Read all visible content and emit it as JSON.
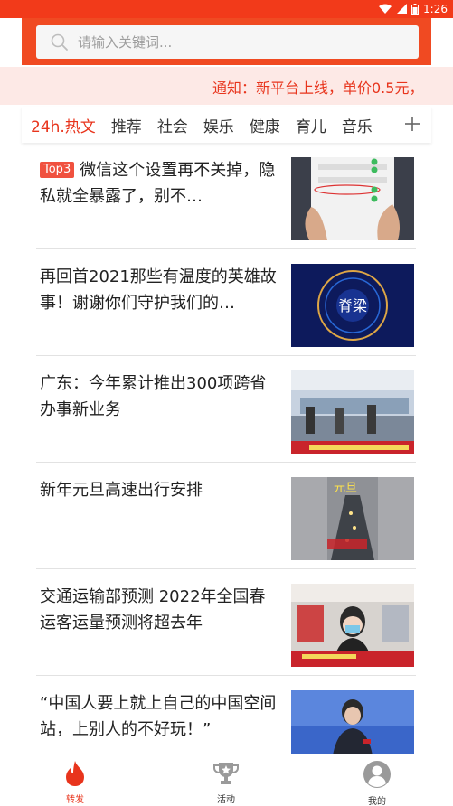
{
  "status_bar": {
    "time": "1:26"
  },
  "search": {
    "placeholder": "请输入关键词..."
  },
  "notice": {
    "text": "通知：新平台上线，单价0.5元，"
  },
  "tabs": [
    {
      "label": "24h.热文",
      "active": true
    },
    {
      "label": "推荐"
    },
    {
      "label": "社会"
    },
    {
      "label": "娱乐"
    },
    {
      "label": "健康"
    },
    {
      "label": "育儿"
    },
    {
      "label": "音乐"
    }
  ],
  "articles": [
    {
      "badge": "Top3",
      "title": "微信这个设置再不关掉，隐私就全暴露了，别不…",
      "image_text": ""
    },
    {
      "title": "再回首2021那些有温度的英雄故事！谢谢你们守护我们的…",
      "image_text": "脊梁"
    },
    {
      "title": "广东：今年累计推出300项跨省办事新业务",
      "image_text": ""
    },
    {
      "title": "新年元旦高速出行安排",
      "image_text": "元旦"
    },
    {
      "title": "交通运输部预测 2022年全国春运客运量预测将超去年",
      "image_text": ""
    },
    {
      "title": "“中国人要上就上自己的中国空间站，上别人的不好玩！”",
      "image_text": ""
    }
  ],
  "bottom_nav": [
    {
      "label": "转发",
      "icon": "flame-icon",
      "active": true
    },
    {
      "label": "活动",
      "icon": "trophy-icon"
    },
    {
      "label": "我的",
      "icon": "user-icon"
    }
  ],
  "colors": {
    "brand": "#f04a22",
    "accent": "#e8341c",
    "notice_bg": "#fde9e6"
  }
}
